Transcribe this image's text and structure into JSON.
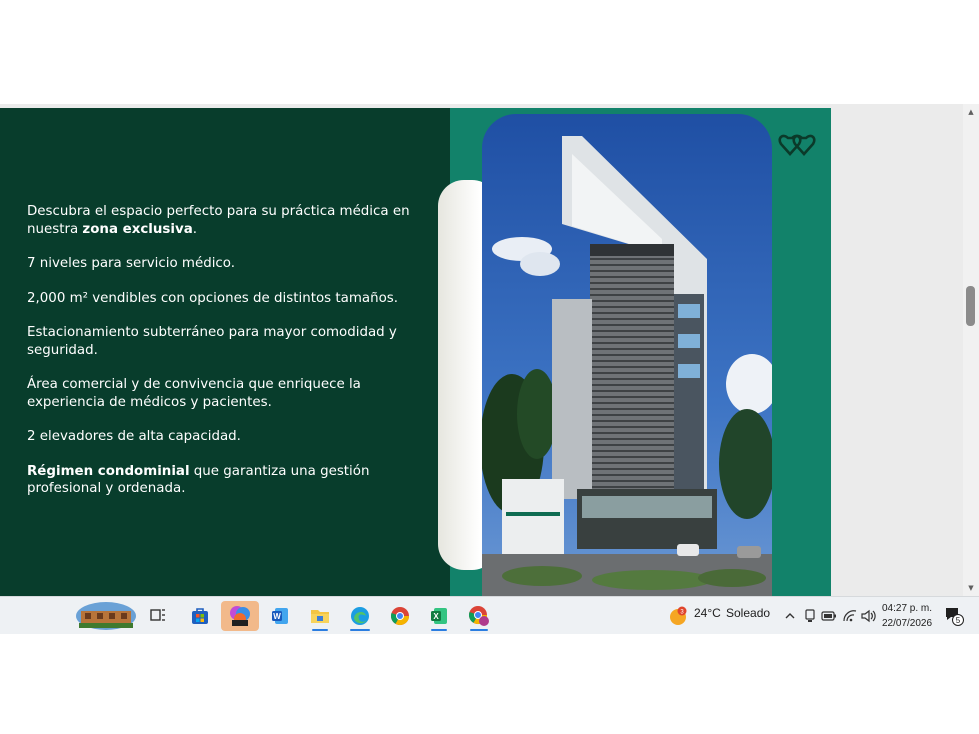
{
  "slide": {
    "paragraphs": [
      {
        "pre": "Descubra el espacio perfecto para su práctica médica en nuestra ",
        "bold": "zona exclusiva",
        "post": "."
      },
      {
        "pre": "7 niveles para servicio médico.",
        "bold": "",
        "post": ""
      },
      {
        "pre": "2,000 m² vendibles con opciones de distintos tamaños.",
        "bold": "",
        "post": ""
      },
      {
        "pre": "Estacionamiento subterráneo para mayor comodidad y seguridad.",
        "bold": "",
        "post": ""
      },
      {
        "pre": "Área comercial y de convivencia que enriquece la experiencia de médicos y pacientes.",
        "bold": "",
        "post": ""
      },
      {
        "pre": "2 elevadores de alta capacidad.",
        "bold": "",
        "post": ""
      },
      {
        "pre": "",
        "bold": "Régimen condominial",
        "post": " que garantiza una gestión profesional y ordenada."
      }
    ],
    "colors": {
      "dark_green": "#083d2c",
      "teal": "#12826a"
    },
    "photo_icon": "building-render-image",
    "logo_icon": "double-heart-logo-icon"
  },
  "taskbar": {
    "apps": [
      {
        "name": "widgets-thumbnail",
        "icon": "landscape-thumbnail-icon"
      },
      {
        "name": "task-view",
        "icon": "task-view-icon"
      },
      {
        "name": "store",
        "icon": "store-icon"
      },
      {
        "name": "copilot",
        "icon": "copilot-icon"
      },
      {
        "name": "word",
        "icon": "word-icon"
      },
      {
        "name": "file-explorer",
        "icon": "folder-icon"
      },
      {
        "name": "edge",
        "icon": "edge-icon"
      },
      {
        "name": "chrome",
        "icon": "chrome-icon"
      },
      {
        "name": "excel",
        "icon": "excel-icon"
      },
      {
        "name": "chrome-profile",
        "icon": "chrome-profile-icon"
      }
    ],
    "weather": {
      "badge": "3",
      "temperature": "24°C",
      "condition": "Soleado"
    },
    "clock": {
      "time": "04:27 p. m.",
      "date": "22/07/2026"
    },
    "notifications_count": "5"
  }
}
